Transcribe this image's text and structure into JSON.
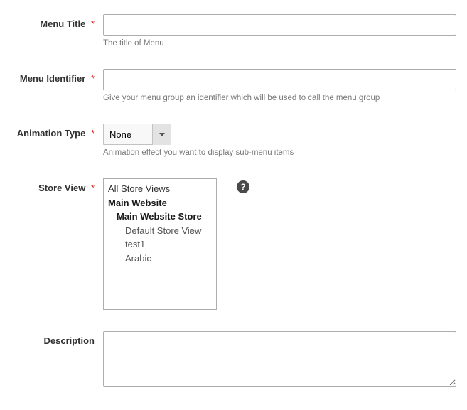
{
  "fields": {
    "menu_title": {
      "label": "Menu Title",
      "value": "",
      "hint": "The title of Menu"
    },
    "menu_identifier": {
      "label": "Menu Identifier",
      "value": "",
      "hint": "Give your menu group an identifier which will be used to call the menu group"
    },
    "animation_type": {
      "label": "Animation Type",
      "selected": "None",
      "hint": "Animation effect you want to display sub-menu items"
    },
    "store_view": {
      "label": "Store View",
      "options": [
        {
          "label": "All Store Views",
          "level": 0
        },
        {
          "label": "Main Website",
          "level": 1
        },
        {
          "label": "Main Website Store",
          "level": 2
        },
        {
          "label": "Default Store View",
          "level": 3
        },
        {
          "label": "test1",
          "level": 3
        },
        {
          "label": "Arabic",
          "level": 3
        }
      ]
    },
    "description": {
      "label": "Description",
      "value": ""
    }
  },
  "required_mark": "*",
  "help_icon": "?"
}
